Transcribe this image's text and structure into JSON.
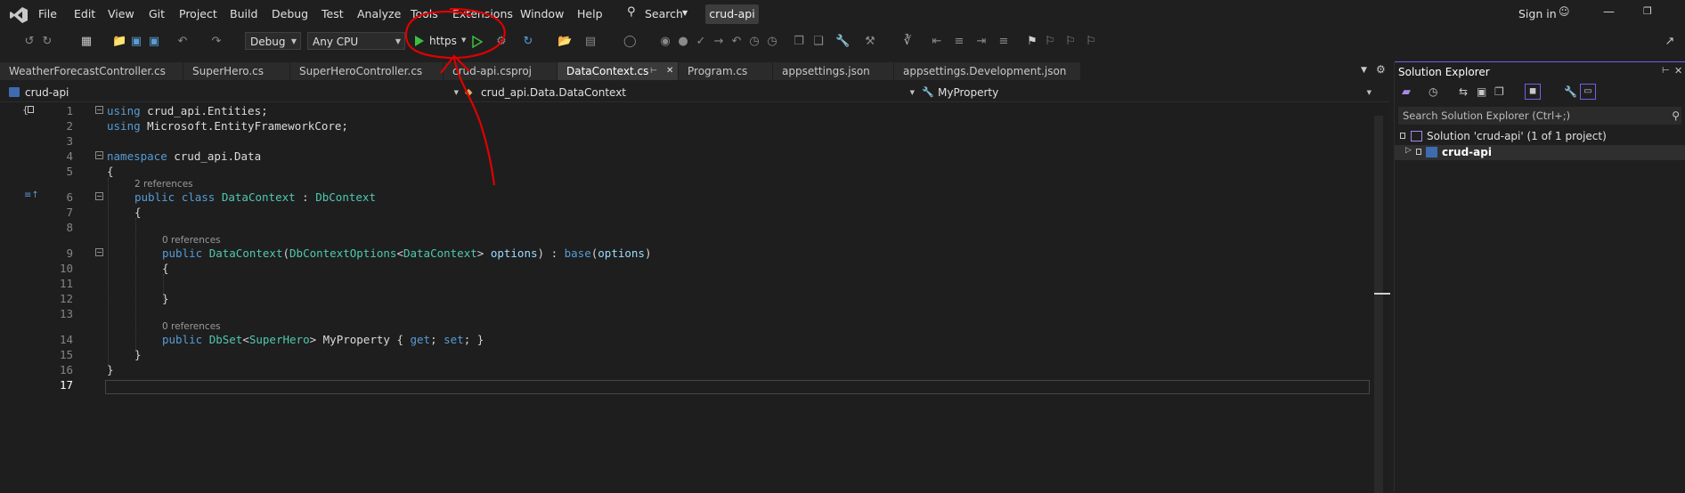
{
  "menubar": {
    "items": [
      "File",
      "Edit",
      "View",
      "Git",
      "Project",
      "Build",
      "Debug",
      "Test",
      "Analyze",
      "Tools",
      "Extensions",
      "Window",
      "Help"
    ],
    "search_label": "Search",
    "solution_name": "crud-api",
    "signin_label": "Sign in"
  },
  "toolbar": {
    "config": "Debug",
    "platform": "Any CPU",
    "run_profile": "https"
  },
  "tabs": [
    {
      "label": "WeatherForecastController.cs",
      "active": false
    },
    {
      "label": "SuperHero.cs",
      "active": false
    },
    {
      "label": "SuperHeroController.cs",
      "active": false
    },
    {
      "label": "crud-api.csproj",
      "active": false
    },
    {
      "label": "DataContext.cs",
      "active": true
    },
    {
      "label": "Program.cs",
      "active": false
    },
    {
      "label": "appsettings.json",
      "active": false
    },
    {
      "label": "appsettings.Development.json",
      "active": false
    }
  ],
  "navbar": {
    "project": "crud-api",
    "type": "crud_api.Data.DataContext",
    "member": "MyProperty"
  },
  "editor": {
    "line_numbers": [
      "1",
      "2",
      "3",
      "4",
      "5",
      "6",
      "7",
      "8",
      "9",
      "10",
      "11",
      "12",
      "13",
      "14",
      "15",
      "16",
      "17"
    ],
    "current_line": "17",
    "codelens": {
      "class_refs": "2 references",
      "ctor_refs": "0 references",
      "prop_refs": "0 references"
    },
    "lines": {
      "l1": {
        "kw": "using",
        "rest": " crud_api.Entities;"
      },
      "l2": {
        "kw": "using",
        "rest": " Microsoft.EntityFrameworkCore;"
      },
      "l4": {
        "kw": "namespace",
        "rest": " crud_api.Data"
      },
      "l5": "{",
      "l6": {
        "kw1": "public",
        "kw2": "class",
        "type": "DataContext",
        "sep": " : ",
        "base": "DbContext"
      },
      "l7": "{",
      "l9": {
        "kw": "public",
        "name": "DataContext",
        "open": "(",
        "type1": "DbContextOptions",
        "lt": "<",
        "type2": "DataContext",
        "gt": ">",
        "param": "options",
        "mid": ") : ",
        "base": "base",
        "open2": "(",
        "arg": "options",
        "close": ")"
      },
      "l10": "{",
      "l12": "}",
      "l14": {
        "kw": "public",
        "type1": "DbSet",
        "lt": "<",
        "type2": "SuperHero",
        "gt": ">",
        "name": "MyProperty",
        "ob": " { ",
        "get": "get",
        "semi1": "; ",
        "set": "set",
        "semi2": "; }"
      },
      "l15": "}",
      "l16": "}"
    }
  },
  "solution_explorer": {
    "title": "Solution Explorer",
    "search_placeholder": "Search Solution Explorer (Ctrl+;)",
    "solution_label": "Solution 'crud-api' (1 of 1 project)",
    "project_label": "crud-api"
  },
  "colors": {
    "annotation": "#e00000",
    "accent": "#7160e8",
    "run_green": "#3fbf3f"
  }
}
